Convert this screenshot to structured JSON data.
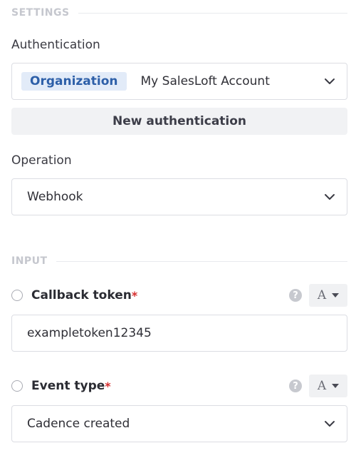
{
  "settings": {
    "section_label": "SETTINGS",
    "authentication": {
      "label": "Authentication",
      "tag": "Organization",
      "value": "My SalesLoft Account",
      "new_button": "New authentication"
    },
    "operation": {
      "label": "Operation",
      "value": "Webhook"
    }
  },
  "input": {
    "section_label": "INPUT",
    "fields": [
      {
        "name": "Callback token",
        "required_mark": "*",
        "help": "?",
        "type_letter": "A",
        "value": "exampletoken12345"
      },
      {
        "name": "Event type",
        "required_mark": "*",
        "help": "?",
        "type_letter": "A",
        "value": "Cadence created"
      }
    ]
  },
  "colors": {
    "tag_bg": "#e2ebf8",
    "tag_text": "#2d5fa8",
    "required": "#d62f2f"
  }
}
